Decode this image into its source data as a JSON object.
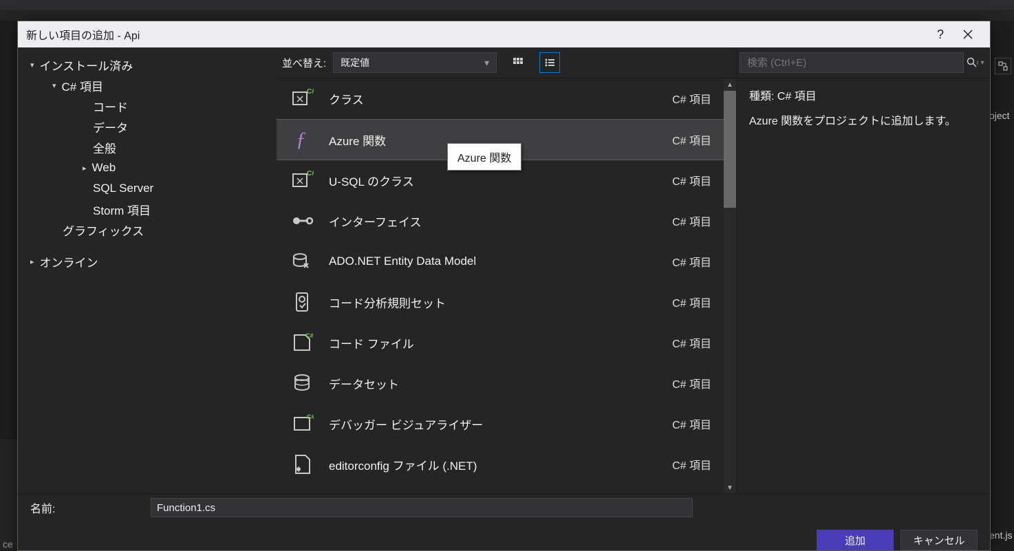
{
  "window": {
    "title": "新しい項目の追加 - Api"
  },
  "tree": {
    "root": "インストール済み",
    "csharp": "C# 項目",
    "items": [
      "コード",
      "データ",
      "全般",
      "Web",
      "SQL Server",
      "Storm 項目"
    ],
    "graphics": "グラフィックス",
    "online": "オンライン"
  },
  "sort": {
    "label": "並べ替え:",
    "value": "既定値"
  },
  "templates": [
    {
      "label": "クラス",
      "cat": "C# 項目",
      "icon": "class"
    },
    {
      "label": "Azure 関数",
      "cat": "C# 項目",
      "icon": "func",
      "selected": true
    },
    {
      "label": "U-SQL のクラス",
      "cat": "C# 項目",
      "icon": "class"
    },
    {
      "label": "インターフェイス",
      "cat": "C# 項目",
      "icon": "iface"
    },
    {
      "label": "ADO.NET Entity Data Model",
      "cat": "C# 項目",
      "icon": "edm"
    },
    {
      "label": "コード分析規則セット",
      "cat": "C# 項目",
      "icon": "rules"
    },
    {
      "label": "コード ファイル",
      "cat": "C# 項目",
      "icon": "cfile"
    },
    {
      "label": "データセット",
      "cat": "C# 項目",
      "icon": "dset"
    },
    {
      "label": "デバッガー ビジュアライザー",
      "cat": "C# 項目",
      "icon": "dbgvis"
    },
    {
      "label": "editorconfig ファイル (.NET)",
      "cat": "C# 項目",
      "icon": "editorcfg"
    }
  ],
  "tooltip": "Azure 関数",
  "search": {
    "placeholder": "検索 (Ctrl+E)"
  },
  "details": {
    "kind_label": "種類:",
    "kind_value": "C# 項目",
    "desc": "Azure 関数をプロジェクトに追加します。"
  },
  "name": {
    "label": "名前:",
    "value": "Function1.cs"
  },
  "buttons": {
    "ok": "追加",
    "cancel": "キャンセル"
  },
  "bg": {
    "project": "oject",
    "entjs": "ent.js",
    "ce": "ce"
  }
}
